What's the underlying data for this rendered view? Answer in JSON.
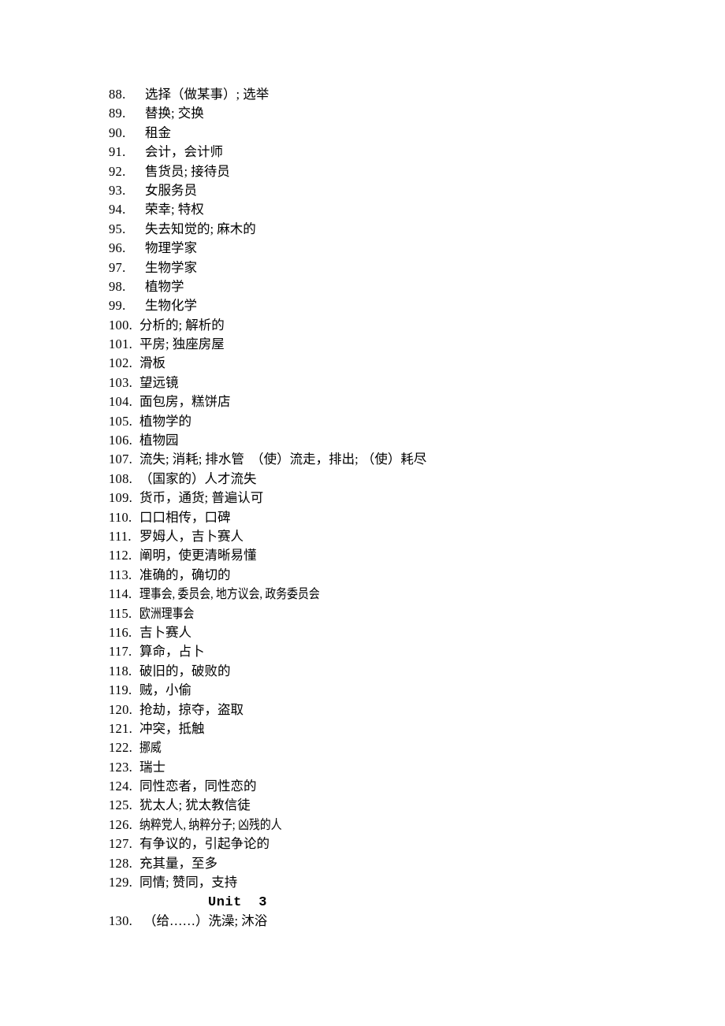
{
  "page": {
    "background_color": "#ffffff",
    "text_color": "#000000"
  },
  "vocab_list": {
    "entries": [
      {
        "number": "88.",
        "text": "选择（做某事）; 选举"
      },
      {
        "number": "89.",
        "text": "替换; 交换"
      },
      {
        "number": "90.",
        "text": "租金"
      },
      {
        "number": "91.",
        "text": "会计，会计师"
      },
      {
        "number": "92.",
        "text": "售货员; 接待员"
      },
      {
        "number": "93.",
        "text": "女服务员"
      },
      {
        "number": "94.",
        "text": "荣幸; 特权"
      },
      {
        "number": "95.",
        "text": "失去知觉的; 麻木的"
      },
      {
        "number": "96.",
        "text": "物理学家"
      },
      {
        "number": "97.",
        "text": "生物学家"
      },
      {
        "number": "98.",
        "text": "植物学"
      },
      {
        "number": "99.",
        "text": "生物化学"
      },
      {
        "number": "100.",
        "text": "分析的; 解析的"
      },
      {
        "number": "101.",
        "text": "平房; 独座房屋"
      },
      {
        "number": "102.",
        "text": "滑板"
      },
      {
        "number": "103.",
        "text": "望远镜"
      },
      {
        "number": "104.",
        "text": "面包房，糕饼店"
      },
      {
        "number": "105.",
        "text": "植物学的"
      },
      {
        "number": "106.",
        "text": "植物园"
      },
      {
        "number": "107.",
        "text": "流失; 消耗; 排水管　（使）流走，排出; （使）耗尽"
      },
      {
        "number": "108.",
        "text": "（国家的）人才流失"
      },
      {
        "number": "109.",
        "text": "货币，通货; 普遍认可"
      },
      {
        "number": "110.",
        "text": "口口相传，口碑"
      },
      {
        "number": "111.",
        "text": "罗姆人，吉卜赛人"
      },
      {
        "number": "112.",
        "text": "阐明，使更清晰易懂"
      },
      {
        "number": "113.",
        "text": "准确的，确切的"
      },
      {
        "number": "114.",
        "text": "理事会, 委员会, 地方议会, 政务委员会"
      },
      {
        "number": "115.",
        "text": "欧洲理事会"
      },
      {
        "number": "116.",
        "text": "吉卜赛人"
      },
      {
        "number": "117.",
        "text": "算命，占卜"
      },
      {
        "number": "118.",
        "text": "破旧的，破败的"
      },
      {
        "number": "119.",
        "text": "贼，小偷"
      },
      {
        "number": "120.",
        "text": "抢劫，掠夺，盗取"
      },
      {
        "number": "121.",
        "text": "冲突，抵触"
      },
      {
        "number": "122.",
        "text": "挪威"
      },
      {
        "number": "123.",
        "text": "瑞士"
      },
      {
        "number": "124.",
        "text": "同性恋者，同性恋的"
      },
      {
        "number": "125.",
        "text": "犹太人; 犹太教信徒"
      },
      {
        "number": "126.",
        "text": "纳粹党人, 纳粹分子; 凶残的人"
      },
      {
        "number": "127.",
        "text": "有争议的，引起争论的"
      },
      {
        "number": "128.",
        "text": "充其量，至多"
      },
      {
        "number": "129.",
        "text": "同情; 赞同，支持"
      }
    ],
    "unit_heading": "Unit  3",
    "last_entry": {
      "number": "130.",
      "text": "（给……）洗澡; 沐浴"
    }
  }
}
